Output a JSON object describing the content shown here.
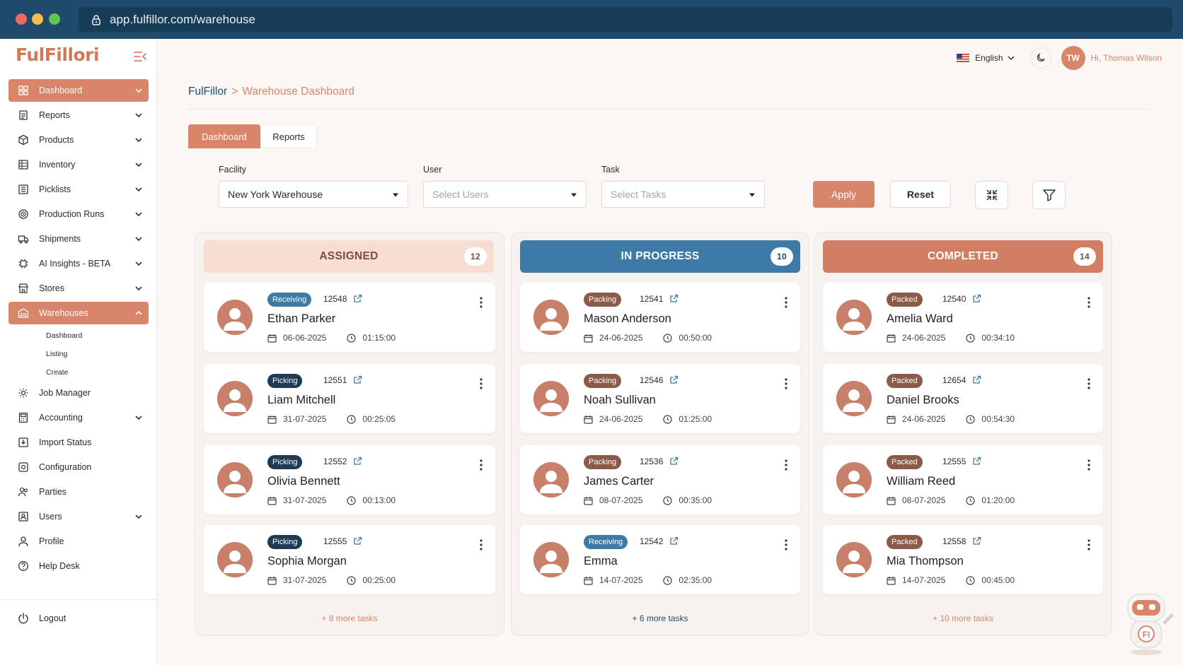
{
  "browser": {
    "url": "app.fulfillor.com/warehouse"
  },
  "brand": {
    "logo_text": "FulFillori"
  },
  "colors": {
    "accent": "#d9856a",
    "navy": "#1f4a6b",
    "progress": "#3d7aa5"
  },
  "sidebar": {
    "items": [
      {
        "label": "Dashboard",
        "icon": "dashboard-icon",
        "expandable": true,
        "active": true
      },
      {
        "label": "Reports",
        "icon": "reports-icon",
        "expandable": true
      },
      {
        "label": "Products",
        "icon": "box-icon",
        "expandable": true
      },
      {
        "label": "Inventory",
        "icon": "inventory-icon",
        "expandable": true
      },
      {
        "label": "Picklists",
        "icon": "list-icon",
        "expandable": true
      },
      {
        "label": "Production Runs",
        "icon": "target-icon",
        "expandable": true
      },
      {
        "label": "Shipments",
        "icon": "truck-icon",
        "expandable": true
      },
      {
        "label": "AI Insights - BETA",
        "icon": "ai-icon",
        "expandable": true
      },
      {
        "label": "Stores",
        "icon": "store-icon",
        "expandable": true
      },
      {
        "label": "Warehouses",
        "icon": "warehouse-icon",
        "expandable": true,
        "active": true,
        "open": true
      }
    ],
    "warehouse_sub": [
      "Dashboard",
      "Listing",
      "Create"
    ],
    "items_after": [
      {
        "label": "Job Manager",
        "icon": "job-icon",
        "expandable": false
      },
      {
        "label": "Accounting",
        "icon": "accounting-icon",
        "expandable": true
      },
      {
        "label": "Import Status",
        "icon": "import-icon",
        "expandable": false
      },
      {
        "label": "Configuration",
        "icon": "config-icon",
        "expandable": false
      },
      {
        "label": "Parties",
        "icon": "parties-icon",
        "expandable": false
      },
      {
        "label": "Users",
        "icon": "users-icon",
        "expandable": true
      },
      {
        "label": "Profile",
        "icon": "profile-icon",
        "expandable": false
      },
      {
        "label": "Help Desk",
        "icon": "help-icon",
        "expandable": false
      }
    ],
    "logout_label": "Logout"
  },
  "topbar": {
    "language": "English",
    "user_initials": "TW",
    "greeting": "Hi, Thomas Wilson"
  },
  "breadcrumb": {
    "root": "FulFillor",
    "sep": ">",
    "current": "Warehouse Dashboard"
  },
  "tabs": [
    {
      "label": "Dashboard",
      "active": true
    },
    {
      "label": "Reports",
      "active": false
    }
  ],
  "filters": {
    "facility": {
      "label": "Facility",
      "value": "New York Warehouse"
    },
    "user": {
      "label": "User",
      "placeholder": "Select Users"
    },
    "task": {
      "label": "Task",
      "placeholder": "Select Tasks"
    },
    "apply_label": "Apply",
    "reset_label": "Reset"
  },
  "columns": [
    {
      "title": "ASSIGNED",
      "count": "12",
      "more": "+ 8 more tasks",
      "cards": [
        {
          "badge": "Receiving",
          "type": "receiving",
          "id": "12548",
          "name": "Ethan Parker",
          "date": "06-06-2025",
          "time": "01:15:00"
        },
        {
          "badge": "Picking",
          "type": "picking",
          "id": "12551",
          "name": "Liam Mitchell",
          "date": "31-07-2025",
          "time": "00:25:05"
        },
        {
          "badge": "Picking",
          "type": "picking",
          "id": "12552",
          "name": "Olivia Bennett",
          "date": "31-07-2025",
          "time": "00:13:00"
        },
        {
          "badge": "Picking",
          "type": "picking",
          "id": "12555",
          "name": "Sophia Morgan",
          "date": "31-07-2025",
          "time": "00:25:00"
        }
      ]
    },
    {
      "title": "IN PROGRESS",
      "count": "10",
      "more": "+ 6 more tasks",
      "cards": [
        {
          "badge": "Packing",
          "type": "packing",
          "id": "12541",
          "name": "Mason Anderson",
          "date": "24-06-2025",
          "time": "00:50:00"
        },
        {
          "badge": "Packing",
          "type": "packing",
          "id": "12546",
          "name": "Noah Sullivan",
          "date": "24-06-2025",
          "time": "01:25:00"
        },
        {
          "badge": "Packing",
          "type": "packing",
          "id": "12536",
          "name": "James Carter",
          "date": "08-07-2025",
          "time": "00:35:00"
        },
        {
          "badge": "Receiving",
          "type": "receiving",
          "id": "12542",
          "name": "Emma",
          "date": "14-07-2025",
          "time": "02:35:00"
        }
      ]
    },
    {
      "title": "COMPLETED",
      "count": "14",
      "more": "+ 10 more tasks",
      "cards": [
        {
          "badge": "Packed",
          "type": "packed",
          "id": "12540",
          "name": "Amelia Ward",
          "date": "24-06-2025",
          "time": "00:34:10"
        },
        {
          "badge": "Packed",
          "type": "packed",
          "id": "12654",
          "name": "Daniel Brooks",
          "date": "24-06-2025",
          "time": "00:54:30"
        },
        {
          "badge": "Packed",
          "type": "packed",
          "id": "12555",
          "name": "William Reed",
          "date": "08-07-2025",
          "time": "01:20:00"
        },
        {
          "badge": "Packed",
          "type": "packed",
          "id": "12558",
          "name": "Mia Thompson",
          "date": "14-07-2025",
          "time": "00:45:00"
        }
      ]
    }
  ],
  "assistant": {
    "badge_text": "FI"
  }
}
